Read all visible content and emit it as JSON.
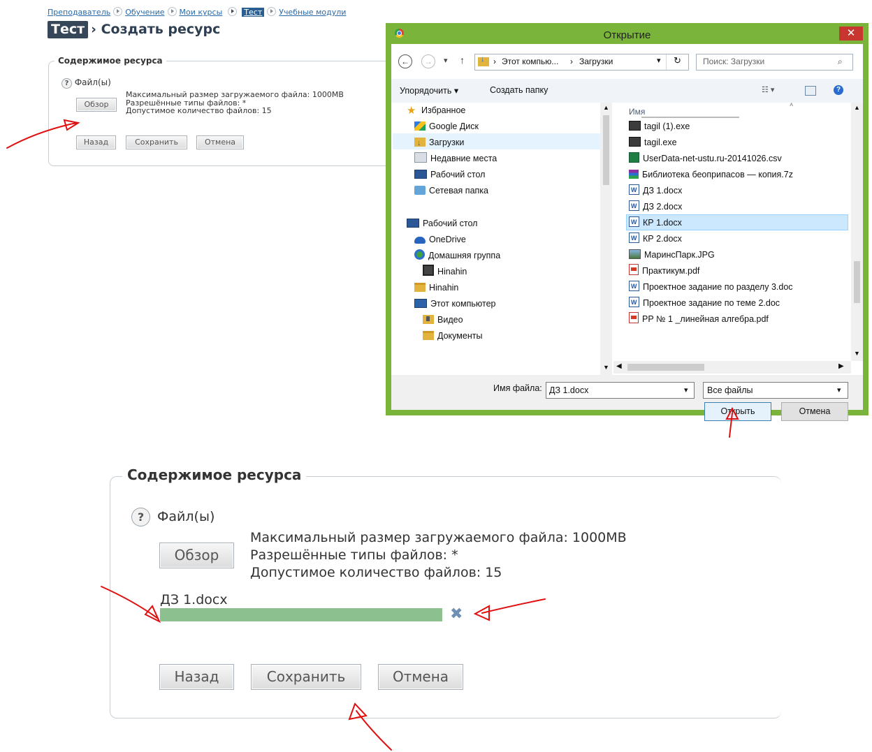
{
  "breadcrumb": {
    "items": [
      "Преподаватель",
      "Обучение",
      "Мои курсы",
      "Тест",
      "Учебные модули"
    ]
  },
  "header": {
    "tag": "Тест",
    "title": "› Создать ресурс"
  },
  "form": {
    "legend": "Содержимое ресурса",
    "help_icon": "?",
    "field_label": "Файл(ы)",
    "browse_label": "Обзор",
    "info": [
      "Максимальный размер загружаемого файла: 1000MB",
      "Разрешённые типы файлов: *",
      "Допустимое количество файлов: 15"
    ],
    "back_label": "Назад",
    "save_label": "Сохранить",
    "cancel_label": "Отмена"
  },
  "zoomed_form": {
    "legend": "Содержимое ресурса",
    "help_icon": "?",
    "field_label": "Файл(ы)",
    "browse_label": "Обзор",
    "info": [
      "Максимальный размер загружаемого файла: 1000MB",
      "Разрешённые типы файлов: *",
      "Допустимое количество файлов: 15"
    ],
    "uploaded_file": "ДЗ 1.docx",
    "upload_progress": 1.0,
    "remove_icon": "✖",
    "back_label": "Назад",
    "save_label": "Сохранить",
    "cancel_label": "Отмена"
  },
  "dialog": {
    "title": "Открытие",
    "close_glyph": "✕",
    "nav": {
      "back": "←",
      "forward": "→",
      "dropdown": "▾",
      "up": "↑",
      "refresh": "↻"
    },
    "address": {
      "path1": "Этот компью...",
      "path2": "Загрузки",
      "sep": "›"
    },
    "search_placeholder": "Поиск: Загрузки",
    "toolbar": {
      "organize": "Упорядочить ▾",
      "new_folder": "Создать папку"
    },
    "column_header": "Имя",
    "nav_items": [
      {
        "label": "Избранное",
        "icon": "star-icon"
      },
      {
        "label": "Google Диск",
        "icon": "gdrive-icon"
      },
      {
        "label": "Загрузки",
        "icon": "downloads-icon"
      },
      {
        "label": "Недавние места",
        "icon": "recent-icon"
      },
      {
        "label": "Рабочий стол",
        "icon": "desktop-icon"
      },
      {
        "label": "Сетевая папка",
        "icon": "network-icon"
      },
      {
        "label": "Рабочий стол",
        "icon": "desktop-icon"
      },
      {
        "label": "OneDrive",
        "icon": "onedrive-icon"
      },
      {
        "label": "Домашняя группа",
        "icon": "homegroup-icon"
      },
      {
        "label": "Hinahin",
        "icon": "user-icon"
      },
      {
        "label": "Hinahin",
        "icon": "user-folder-icon"
      },
      {
        "label": "Этот компьютер",
        "icon": "computer-icon"
      },
      {
        "label": "Видео",
        "icon": "video-folder-icon"
      },
      {
        "label": "Документы",
        "icon": "documents-folder-icon"
      }
    ],
    "files": [
      {
        "name": "tagil (1).exe",
        "icon": "7z-icon"
      },
      {
        "name": "tagil.exe",
        "icon": "7z-icon"
      },
      {
        "name": "UserData-net-ustu.ru-20141026.csv",
        "icon": "csv-icon"
      },
      {
        "name": "Библиотека беоприпасов — копия.7z",
        "icon": "rar-icon"
      },
      {
        "name": "ДЗ 1.docx",
        "icon": "word-icon"
      },
      {
        "name": "ДЗ 2.docx",
        "icon": "word-icon"
      },
      {
        "name": "КР 1.docx",
        "icon": "word-icon"
      },
      {
        "name": "КР 2.docx",
        "icon": "word-icon"
      },
      {
        "name": "МаринсПарк.JPG",
        "icon": "image-icon"
      },
      {
        "name": "Практикум.pdf",
        "icon": "pdf-icon"
      },
      {
        "name": "Проектное задание по разделу 3.doc",
        "icon": "word-icon"
      },
      {
        "name": "Проектное задание по теме 2.doc",
        "icon": "word-icon"
      },
      {
        "name": "РР № 1 _линейная алгебра.pdf",
        "icon": "pdf-icon"
      }
    ],
    "selected_file": "ДЗ 1.docx",
    "filename_label": "Имя файла:",
    "filename_value": "ДЗ 1.docx",
    "filetype_value": "Все файлы",
    "open_label": "Открыть",
    "cancel_label": "Отмена"
  },
  "colors": {
    "accent": "#2b5f92",
    "dialog_frame": "#7bb43a",
    "close": "#c7372f",
    "progress": "#8cc18f",
    "annotation": "#e01010"
  }
}
